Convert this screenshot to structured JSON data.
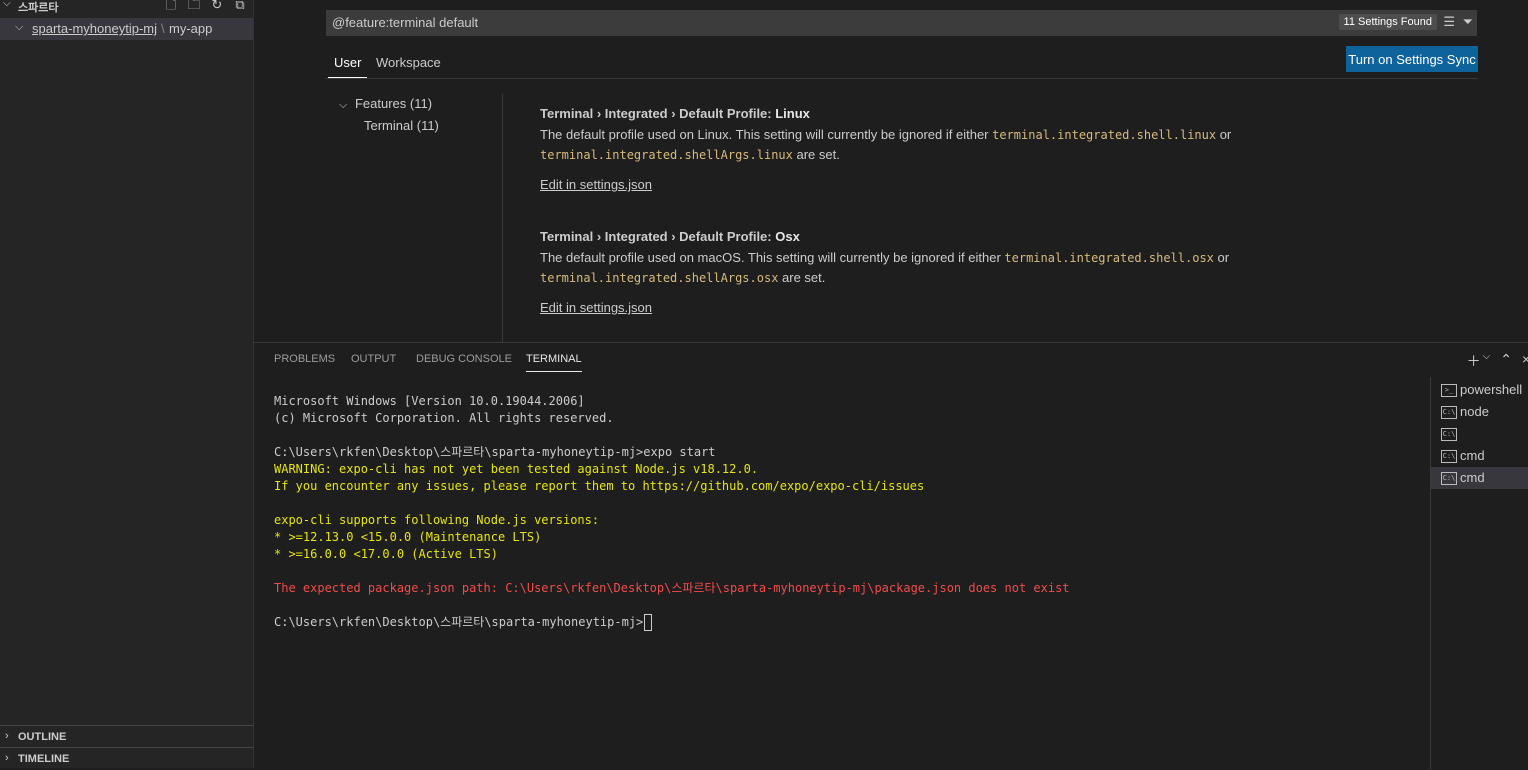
{
  "sidebar": {
    "title": "스파르타",
    "tree": {
      "part1": "sparta-myhoneytip-mj",
      "sep": "\\",
      "part2": "my-app"
    },
    "sections": {
      "outline": "OUTLINE",
      "timeline": "TIMELINE"
    }
  },
  "settings": {
    "search_query": "@feature:terminal default",
    "found": "11 Settings Found",
    "tabs": [
      "User",
      "Workspace"
    ],
    "sync_button": "Turn on Settings Sync",
    "toc": {
      "features": "Features (11)",
      "terminal": "Terminal (11)"
    },
    "items": [
      {
        "category": "Terminal › Integrated › Default Profile: ",
        "name": "Linux",
        "desc_a": "The default profile used on Linux. This setting will currently be ignored if either ",
        "code_a": "terminal.integrated.shell.linux",
        "desc_b": " or",
        "code_b": "terminal.integrated.shellArgs.linux",
        "desc_c": " are set.",
        "edit": "Edit in settings.json"
      },
      {
        "category": "Terminal › Integrated › Default Profile: ",
        "name": "Osx",
        "desc_a": "The default profile used on macOS. This setting will currently be ignored if either ",
        "code_a": "terminal.integrated.shell.osx",
        "desc_b": " or",
        "code_b": "terminal.integrated.shellArgs.osx",
        "desc_c": " are set.",
        "edit": "Edit in settings.json"
      }
    ]
  },
  "panel": {
    "tabs": [
      "PROBLEMS",
      "OUTPUT",
      "DEBUG CONSOLE",
      "TERMINAL"
    ],
    "active_tab": "TERMINAL",
    "terminal_lines": [
      "Microsoft Windows [Version 10.0.19044.2006]",
      "(c) Microsoft Corporation. All rights reserved.",
      "",
      "C:\\Users\\rkfen\\Desktop\\스파르타\\sparta-myhoneytip-mj>expo start",
      "WARNING: expo-cli has not yet been tested against Node.js v18.12.0.",
      "If you encounter any issues, please report them to https://github.com/expo/expo-cli/issues",
      "",
      "expo-cli supports following Node.js versions:",
      "* >=12.13.0 <15.0.0 (Maintenance LTS)",
      "* >=16.0.0 <17.0.0 (Active LTS)",
      "",
      "The expected package.json path: C:\\Users\\rkfen\\Desktop\\스파르타\\sparta-myhoneytip-mj\\package.json does not exist",
      "",
      "C:\\Users\\rkfen\\Desktop\\스파르타\\sparta-myhoneytip-mj>"
    ],
    "terminals": [
      "powershell",
      "node",
      "",
      "cmd",
      "cmd"
    ]
  },
  "colors": {
    "accent": "#0e639c",
    "warning": "#e5e510",
    "error": "#f14c4c",
    "code": "#d7ba7d"
  }
}
